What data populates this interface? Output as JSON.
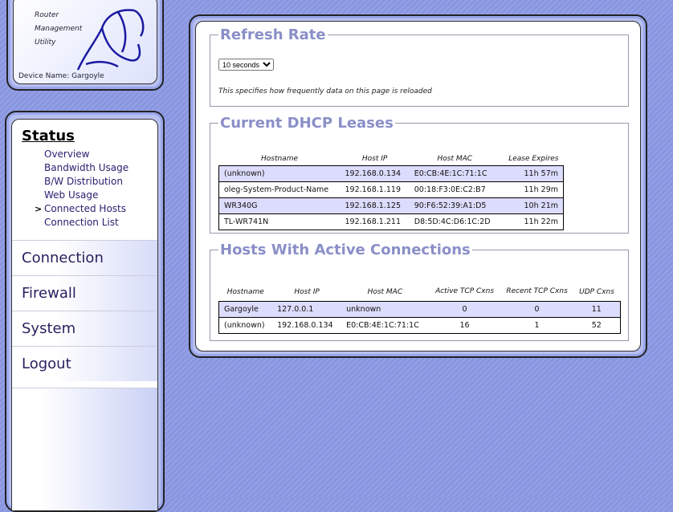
{
  "logo": {
    "lines": [
      "Router",
      "Management",
      "Utility"
    ],
    "device_name": "Device Name: Gargoyle"
  },
  "nav": {
    "section": "Status",
    "current_marker": ">",
    "sub_items": [
      "Overview",
      "Bandwidth Usage",
      "B/W Distribution",
      "Web Usage",
      "Connected Hosts",
      "Connection List"
    ],
    "items": [
      "Connection",
      "Firewall",
      "System",
      "Logout"
    ]
  },
  "refresh": {
    "title": "Refresh Rate",
    "selected": "10 seconds",
    "note": "This specifies how frequently data on this page is reloaded"
  },
  "dhcp": {
    "title": "Current DHCP Leases",
    "headers": [
      "Hostname",
      "Host IP",
      "Host MAC",
      "Lease Expires"
    ],
    "rows": [
      [
        "(unknown)",
        "192.168.0.134",
        "E0:CB:4E:1C:71:1C",
        "11h 57m"
      ],
      [
        "oleg-System-Product-Name",
        "192.168.1.119",
        "00:18:F3:0E:C2:B7",
        "11h 29m"
      ],
      [
        "WR340G",
        "192.168.1.125",
        "90:F6:52:39:A1:D5",
        "10h 21m"
      ],
      [
        "TL-WR741N",
        "192.168.1.211",
        "D8:5D:4C:D6:1C:2D",
        "11h 22m"
      ]
    ]
  },
  "hosts": {
    "title": "Hosts With Active Connections",
    "headers": [
      "Hostname",
      "Host IP",
      "Host MAC",
      "Active TCP Cxns",
      "Recent TCP Cxns",
      "UDP Cxns"
    ],
    "rows": [
      [
        "Gargoyle",
        "127.0.0.1",
        "unknown",
        "0",
        "0",
        "11"
      ],
      [
        "(unknown)",
        "192.168.0.134",
        "E0:CB:4E:1C:71:1C",
        "16",
        "1",
        "52"
      ]
    ]
  }
}
